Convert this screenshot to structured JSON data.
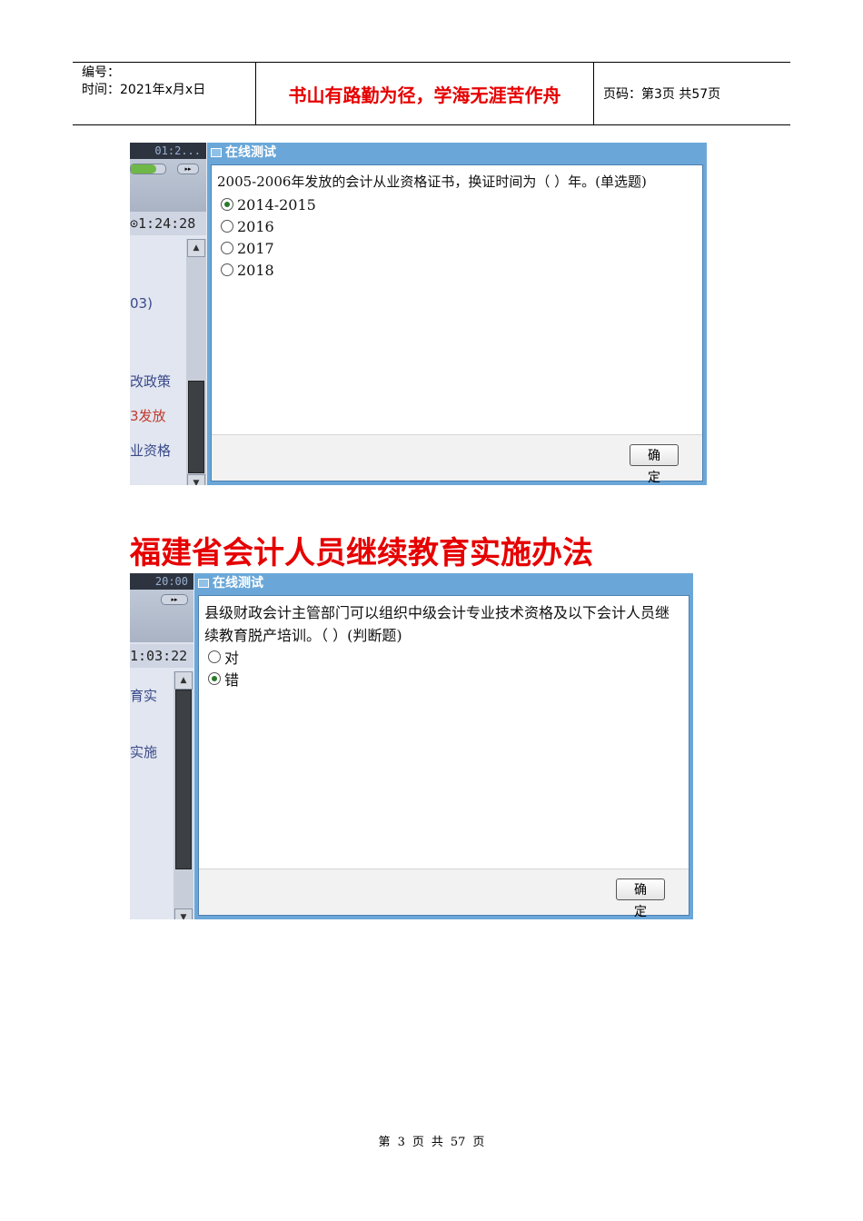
{
  "header": {
    "number_label": "编号：",
    "time_label": "时间：2021年x月x日",
    "motto": "书山有路勤为径，学海无涯苦作舟",
    "page_info": "页码：第3页  共57页"
  },
  "shot1": {
    "side_clock": "01:2...",
    "side_timer": "1:24:28",
    "side_items": [
      "03)",
      "改政策",
      "3发放",
      "业资格"
    ],
    "panel_title": "在线测试",
    "question": "2005-2006年发放的会计从业资格证书，换证时间为（  ）年。(单选题)",
    "options": [
      "2014-2015",
      "2016",
      "2017",
      "2018"
    ],
    "selected_index": 0,
    "ok_label": "确 定"
  },
  "heading": "福建省会计人员继续教育实施办法",
  "shot2": {
    "side_clock": "20:00",
    "side_timer": "1:03:22",
    "side_items": [
      "育实",
      "实施"
    ],
    "panel_title": "在线测试",
    "question": "县级财政会计主管部门可以组织中级会计专业技术资格及以下会计人员继续教育脱产培训。（  ）(判断题)",
    "options": [
      "对",
      "错"
    ],
    "selected_index": 1,
    "ok_label": "确 定"
  },
  "footer": {
    "di": "第",
    "current_page": "3",
    "ye1": "页",
    "gong": "共",
    "total_pages": "57",
    "ye2": "页"
  },
  "colors": {
    "accent_red": "#e60000",
    "panel_blue": "#6aa7d8"
  }
}
